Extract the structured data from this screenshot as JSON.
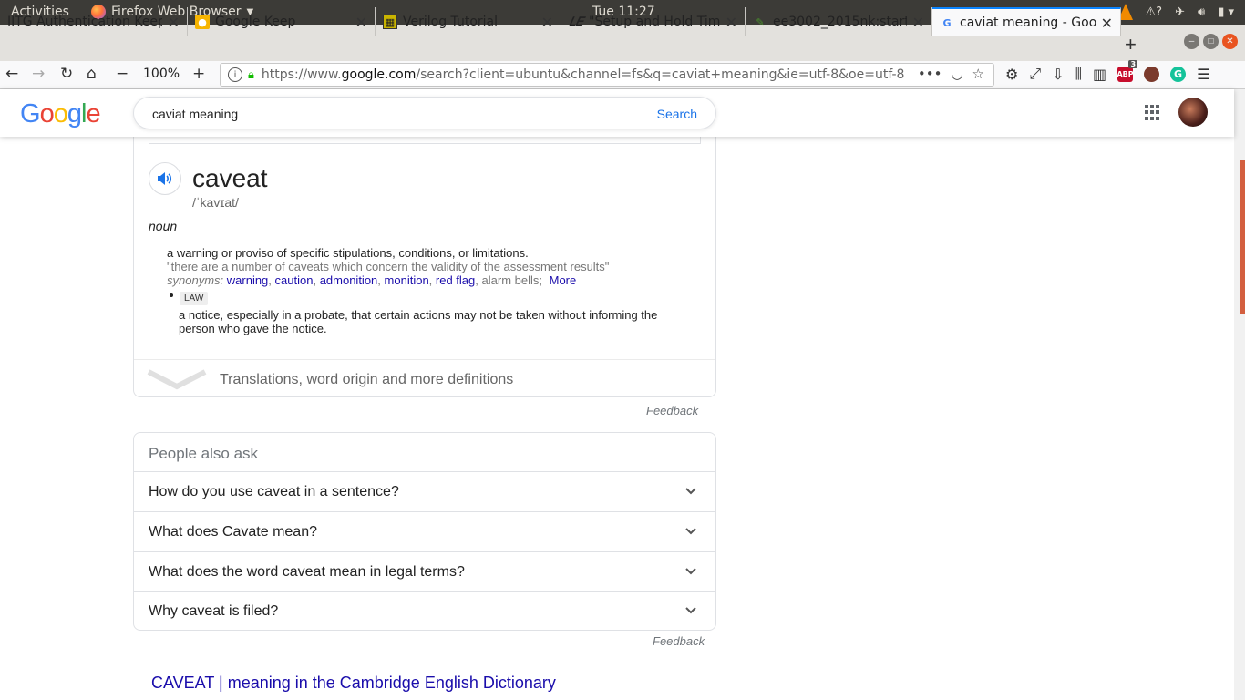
{
  "system_bar": {
    "activities": "Activities",
    "app_name": "Firefox Web Browser",
    "clock": "Tue 11:27"
  },
  "tabs": [
    {
      "label": "IITG Authentication Keep",
      "favicon": "none"
    },
    {
      "label": "Google Keep",
      "favicon": "keep-icon"
    },
    {
      "label": "Verilog Tutorial",
      "favicon": "verilog-icon"
    },
    {
      "label": "\"Setup and Hold Time",
      "favicon": "le-icon"
    },
    {
      "label": "ee3002_2015nk:start",
      "favicon": "wiki-icon"
    },
    {
      "label": "caviat meaning - Goog",
      "favicon": "google-icon",
      "active": true
    }
  ],
  "toolbar": {
    "zoom": "100%",
    "url_prefix": "https://www.",
    "url_domain": "google.com",
    "url_path": "/search?client=ubuntu&channel=fs&q=caviat+meaning&ie=utf-8&oe=utf-8",
    "abp_badge": "3",
    "abp_label": "ABP",
    "grammarly_label": "G"
  },
  "google": {
    "logo_letters": [
      "G",
      "o",
      "o",
      "g",
      "l",
      "e"
    ],
    "logo_colors": [
      "#4285f4",
      "#ea4335",
      "#fbbc05",
      "#4285f4",
      "#34a853",
      "#ea4335"
    ],
    "query": "caviat meaning",
    "search_button": "Search"
  },
  "dictionary": {
    "word": "caveat",
    "pronunciation": "/ˈkavɪat/",
    "part_of_speech": "noun",
    "definition_1": "a warning or proviso of specific stipulations, conditions, or limitations.",
    "example_1": "\"there are a number of caveats which concern the validity of the assessment results\"",
    "synonyms_label": "synonyms:",
    "synonyms": [
      "warning",
      "caution",
      "admonition",
      "monition",
      "red flag"
    ],
    "synonym_plain": "alarm bells;",
    "more_link": "More",
    "tag": "LAW",
    "definition_2": "a notice, especially in a probate, that certain actions may not be taken without informing the person who gave the notice.",
    "expand_label": "Translations, word origin and more definitions",
    "feedback": "Feedback"
  },
  "people_also_ask": {
    "title": "People also ask",
    "questions": [
      "How do you use caveat in a sentence?",
      "What does Cavate mean?",
      "What does the word caveat mean in legal terms?",
      "Why caveat is filed?"
    ],
    "feedback": "Feedback"
  },
  "result": {
    "title": "CAVEAT | meaning in the Cambridge English Dictionary"
  }
}
